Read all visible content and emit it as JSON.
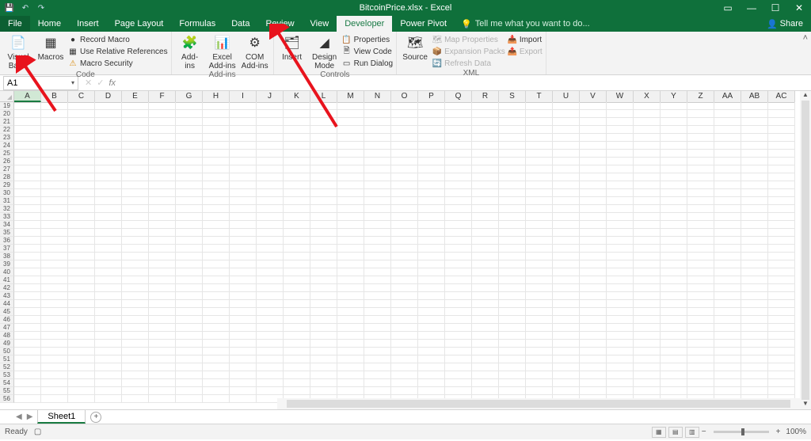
{
  "app": {
    "title": "BitcoinPrice.xlsx - Excel"
  },
  "qat": {
    "save": "💾",
    "undo": "↶",
    "redo": "↷"
  },
  "wincontrols": {
    "ribbonopt": "▭",
    "min": "—",
    "max": "☐",
    "close": "✕"
  },
  "tabs": {
    "file": "File",
    "home": "Home",
    "insert": "Insert",
    "pagelayout": "Page Layout",
    "formulas": "Formulas",
    "data": "Data",
    "review": "Review",
    "view": "View",
    "developer": "Developer",
    "powerpivot": "Power Pivot",
    "tellme": "Tell me what you want to do...",
    "share": "Share"
  },
  "ribbon": {
    "code": {
      "label": "Code",
      "vb": "Visual\nBasic",
      "macros": "Macros",
      "record": "Record Macro",
      "relative": "Use Relative References",
      "security": "Macro Security"
    },
    "addins": {
      "label": "Add-ins",
      "addins_btn": "Add-\nins",
      "excel": "Excel\nAdd-ins",
      "com": "COM\nAdd-ins"
    },
    "controls": {
      "label": "Controls",
      "insert": "Insert",
      "design": "Design\nMode",
      "properties": "Properties",
      "viewcode": "View Code",
      "rundialog": "Run Dialog"
    },
    "xml": {
      "label": "XML",
      "source": "Source",
      "mapprops": "Map Properties",
      "expansion": "Expansion Packs",
      "refresh": "Refresh Data",
      "import": "Import",
      "export": "Export"
    }
  },
  "namebox": {
    "value": "A1"
  },
  "formula": {
    "value": ""
  },
  "columns": [
    "A",
    "B",
    "C",
    "D",
    "E",
    "F",
    "G",
    "H",
    "I",
    "J",
    "K",
    "L",
    "M",
    "N",
    "O",
    "P",
    "Q",
    "R",
    "S",
    "T",
    "U",
    "V",
    "W",
    "X",
    "Y",
    "Z",
    "AA",
    "AB",
    "AC"
  ],
  "row_start": 19,
  "row_end": 56,
  "sheet": {
    "name": "Sheet1"
  },
  "status": {
    "ready": "Ready",
    "zoom": "100%"
  }
}
